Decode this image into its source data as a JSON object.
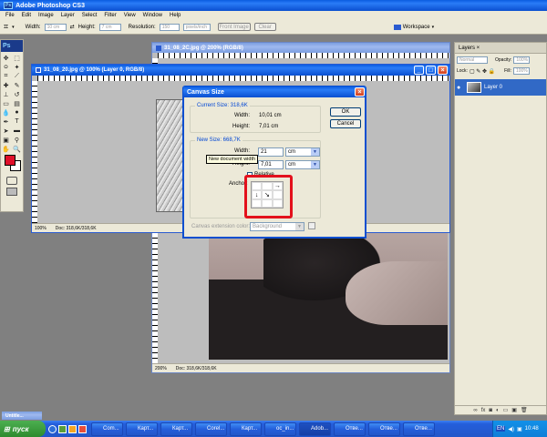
{
  "app": {
    "title": "Adobe Photoshop CS3",
    "menu": [
      "File",
      "Edit",
      "Image",
      "Layer",
      "Select",
      "Filter",
      "View",
      "Window",
      "Help"
    ],
    "workspace_label": "Workspace",
    "ps_badge": "Ps"
  },
  "options_bar": {
    "width_label": "Width:",
    "height_label": "Height:",
    "resolution_label": "Resolution:",
    "width_placeholder": "10 cm",
    "height_placeholder": "7 cm",
    "resolution_placeholder": "150",
    "unit_value": "pixels/inch",
    "front_image_label": "Front Image",
    "clear_label": "Clear"
  },
  "documents": {
    "back": {
      "title": "31_08_2C.jpg @ 200% (RGB/8)",
      "zoom": "200%",
      "status": "Doc: 318,6K/318,6K"
    },
    "front": {
      "title": "31_08_20.jpg @ 100% (Layer 0, RGB/8)",
      "zoom": "100%",
      "status": "Doc: 318,6K/318,6K"
    }
  },
  "dialog": {
    "title": "Canvas Size",
    "ok_label": "OK",
    "cancel_label": "Cancel",
    "current_size": {
      "label": "Current Size: 318,6K",
      "width_label": "Width:",
      "width_value": "10,01 cm",
      "height_label": "Height:",
      "height_value": "7,01 cm"
    },
    "new_size": {
      "label": "New Size: 668,7K",
      "width_label": "Width:",
      "width_value": "21",
      "width_unit": "cm",
      "height_label": "Height:",
      "height_value": "7,01",
      "height_unit": "cm",
      "relative_label": "Relative",
      "anchor_label": "Anchor:",
      "tooltip": "New document width"
    },
    "extension_label": "Canvas extension color:",
    "extension_value": "Background"
  },
  "layers_panel": {
    "tab": "Layers ×",
    "blend_mode": "Normal",
    "opacity_label": "Opacity:",
    "opacity_value": "100%",
    "lock_label": "Lock:",
    "fill_label": "Fill:",
    "fill_value": "100%",
    "layer_name": "Layer 0"
  },
  "minimized_doc": "Untitle...",
  "taskbar": {
    "start_label": "пуск",
    "items": [
      "Com...",
      "Карт...",
      "Карт...",
      "Corel...",
      "Карт...",
      "oc_in...",
      "Adob...",
      "Отве...",
      "Отве...",
      "Отве..."
    ],
    "active_index": 6,
    "language": "EN",
    "time": "10:48"
  },
  "colors": {
    "foreground": "#e0102a",
    "highlight": "#e3101c",
    "xp_blue": "#0a5be0"
  }
}
